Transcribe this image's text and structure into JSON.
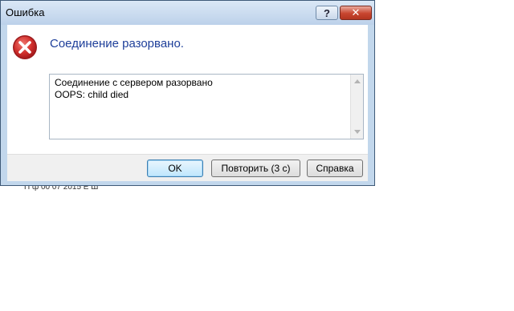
{
  "window": {
    "title": "Ошибка",
    "help_glyph": "?",
    "close_glyph": "✕"
  },
  "message": {
    "heading": "Соединение разорвано.",
    "icon": "error-icon",
    "details": [
      "Соединение с сервером разорвано",
      "OOPS: child died"
    ]
  },
  "buttons": {
    "ok": "OK",
    "retry": "Повторить (3 с)",
    "help": "Справка"
  },
  "background": {
    "partial_text": "П     ф              00 07 2015 Е Ш"
  },
  "colors": {
    "heading": "#1e3f9a",
    "error_red": "#c8252c",
    "frame": "#c2d7ec"
  }
}
